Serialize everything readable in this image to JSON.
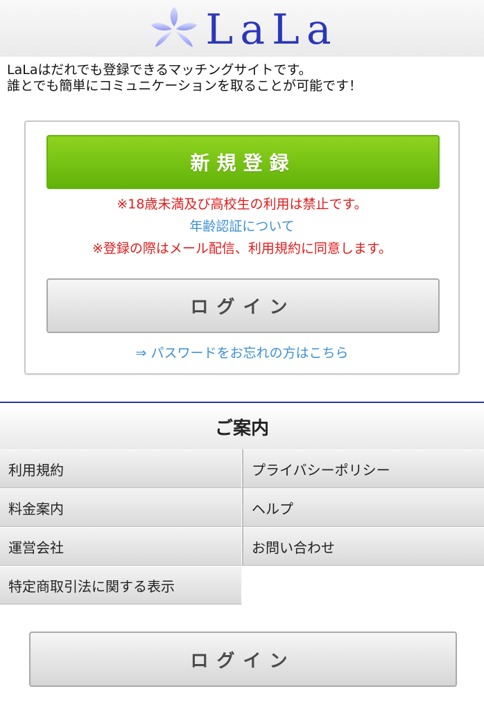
{
  "header": {
    "logo_text": "LaLa",
    "logo_icon": "flower-icon",
    "brand_color": "#2b37b9"
  },
  "intro": {
    "line1": "LaLaはだれでも登録できるマッチングサイトです。",
    "line2": "誰とでも簡単にコミュニケーションを取ることが可能です！"
  },
  "auth_card": {
    "register_label": "新規登録",
    "age_notice": "※18歳未満及び高校生の利用は禁止です。",
    "age_verification_link": "年齢認証について",
    "terms_notice": "※登録の際はメール配信、利用規約に同意します。",
    "login_label": "ログイン",
    "forgot_password_link": "⇒ パスワードをお忘れの方はこちら"
  },
  "guide": {
    "title": "ご案内",
    "items": [
      {
        "label": "利用規約"
      },
      {
        "label": "プライバシーポリシー"
      },
      {
        "label": "料金案内"
      },
      {
        "label": "ヘルプ"
      },
      {
        "label": "運営会社"
      },
      {
        "label": "お問い合わせ"
      },
      {
        "label": "特定商取引法に関する表示"
      }
    ]
  },
  "footer": {
    "login_label": "ログイン"
  },
  "colors": {
    "register_green": "#7cc416",
    "notice_red": "#e01b1b",
    "link_blue": "#3d8fd6",
    "divider_blue": "#2a35b0"
  }
}
